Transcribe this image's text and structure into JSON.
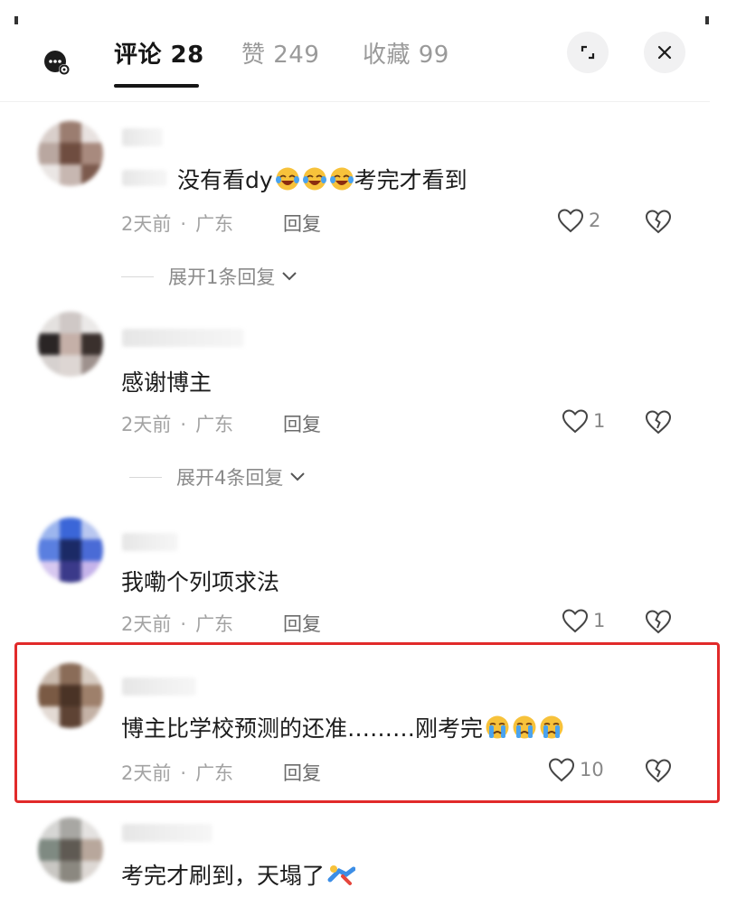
{
  "header": {
    "tabs": [
      {
        "label": "评论 28"
      },
      {
        "label": "赞 249"
      },
      {
        "label": "收藏 99"
      }
    ],
    "close_glyph": "✕"
  },
  "comments": [
    {
      "text": "没有看dy",
      "text_suffix": "考完才看到",
      "emoji": "laughing-crying-emoji",
      "emoji_count": 3,
      "time": "2天前",
      "separator": "·",
      "location": "广东",
      "reply_label": "回复",
      "likes": "2",
      "expand": "展开1条回复"
    },
    {
      "text": "感谢博主",
      "time": "2天前",
      "separator": "·",
      "location": "广东",
      "reply_label": "回复",
      "likes": "1",
      "expand": "展开4条回复"
    },
    {
      "text": "我嘞个列项求法",
      "time": "2天前",
      "separator": "·",
      "location": "广东",
      "reply_label": "回复",
      "likes": "1"
    },
    {
      "text": "博主比学校预测的还准………刚考完",
      "emoji": "crying-emoji",
      "emoji_count": 3,
      "time": "2天前",
      "separator": "·",
      "location": "广东",
      "reply_label": "回复",
      "likes": "10",
      "highlighted": true,
      "highlight_color": "#e12a2a"
    },
    {
      "text": "考完才刷到，天塌了",
      "emoji": "collapsing-figure-emoji"
    }
  ]
}
